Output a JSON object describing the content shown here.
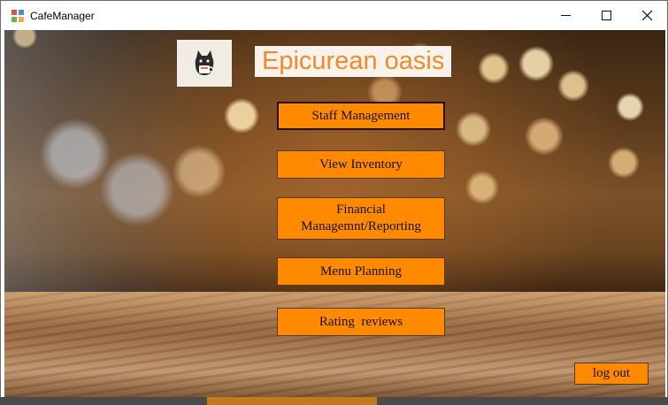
{
  "window": {
    "title": "CafeManager",
    "controls": {
      "minimize": "minimize-icon",
      "maximize": "maximize-icon",
      "close": "close-icon"
    }
  },
  "header": {
    "logo_icon": "cat-with-cup-icon",
    "app_title": "Epicurean oasis"
  },
  "menu": {
    "staff_management": "Staff Management",
    "view_inventory": "View Inventory",
    "financial_line1": "Financial",
    "financial_line2": "Managemnt/Reporting",
    "menu_planning": "Menu Planning",
    "rating_reviews": "Rating  reviews"
  },
  "logout_label": "log out",
  "colors": {
    "button_orange": "#ff8a00",
    "title_orange": "#f28a2c",
    "title_bg": "#fffaf4"
  }
}
